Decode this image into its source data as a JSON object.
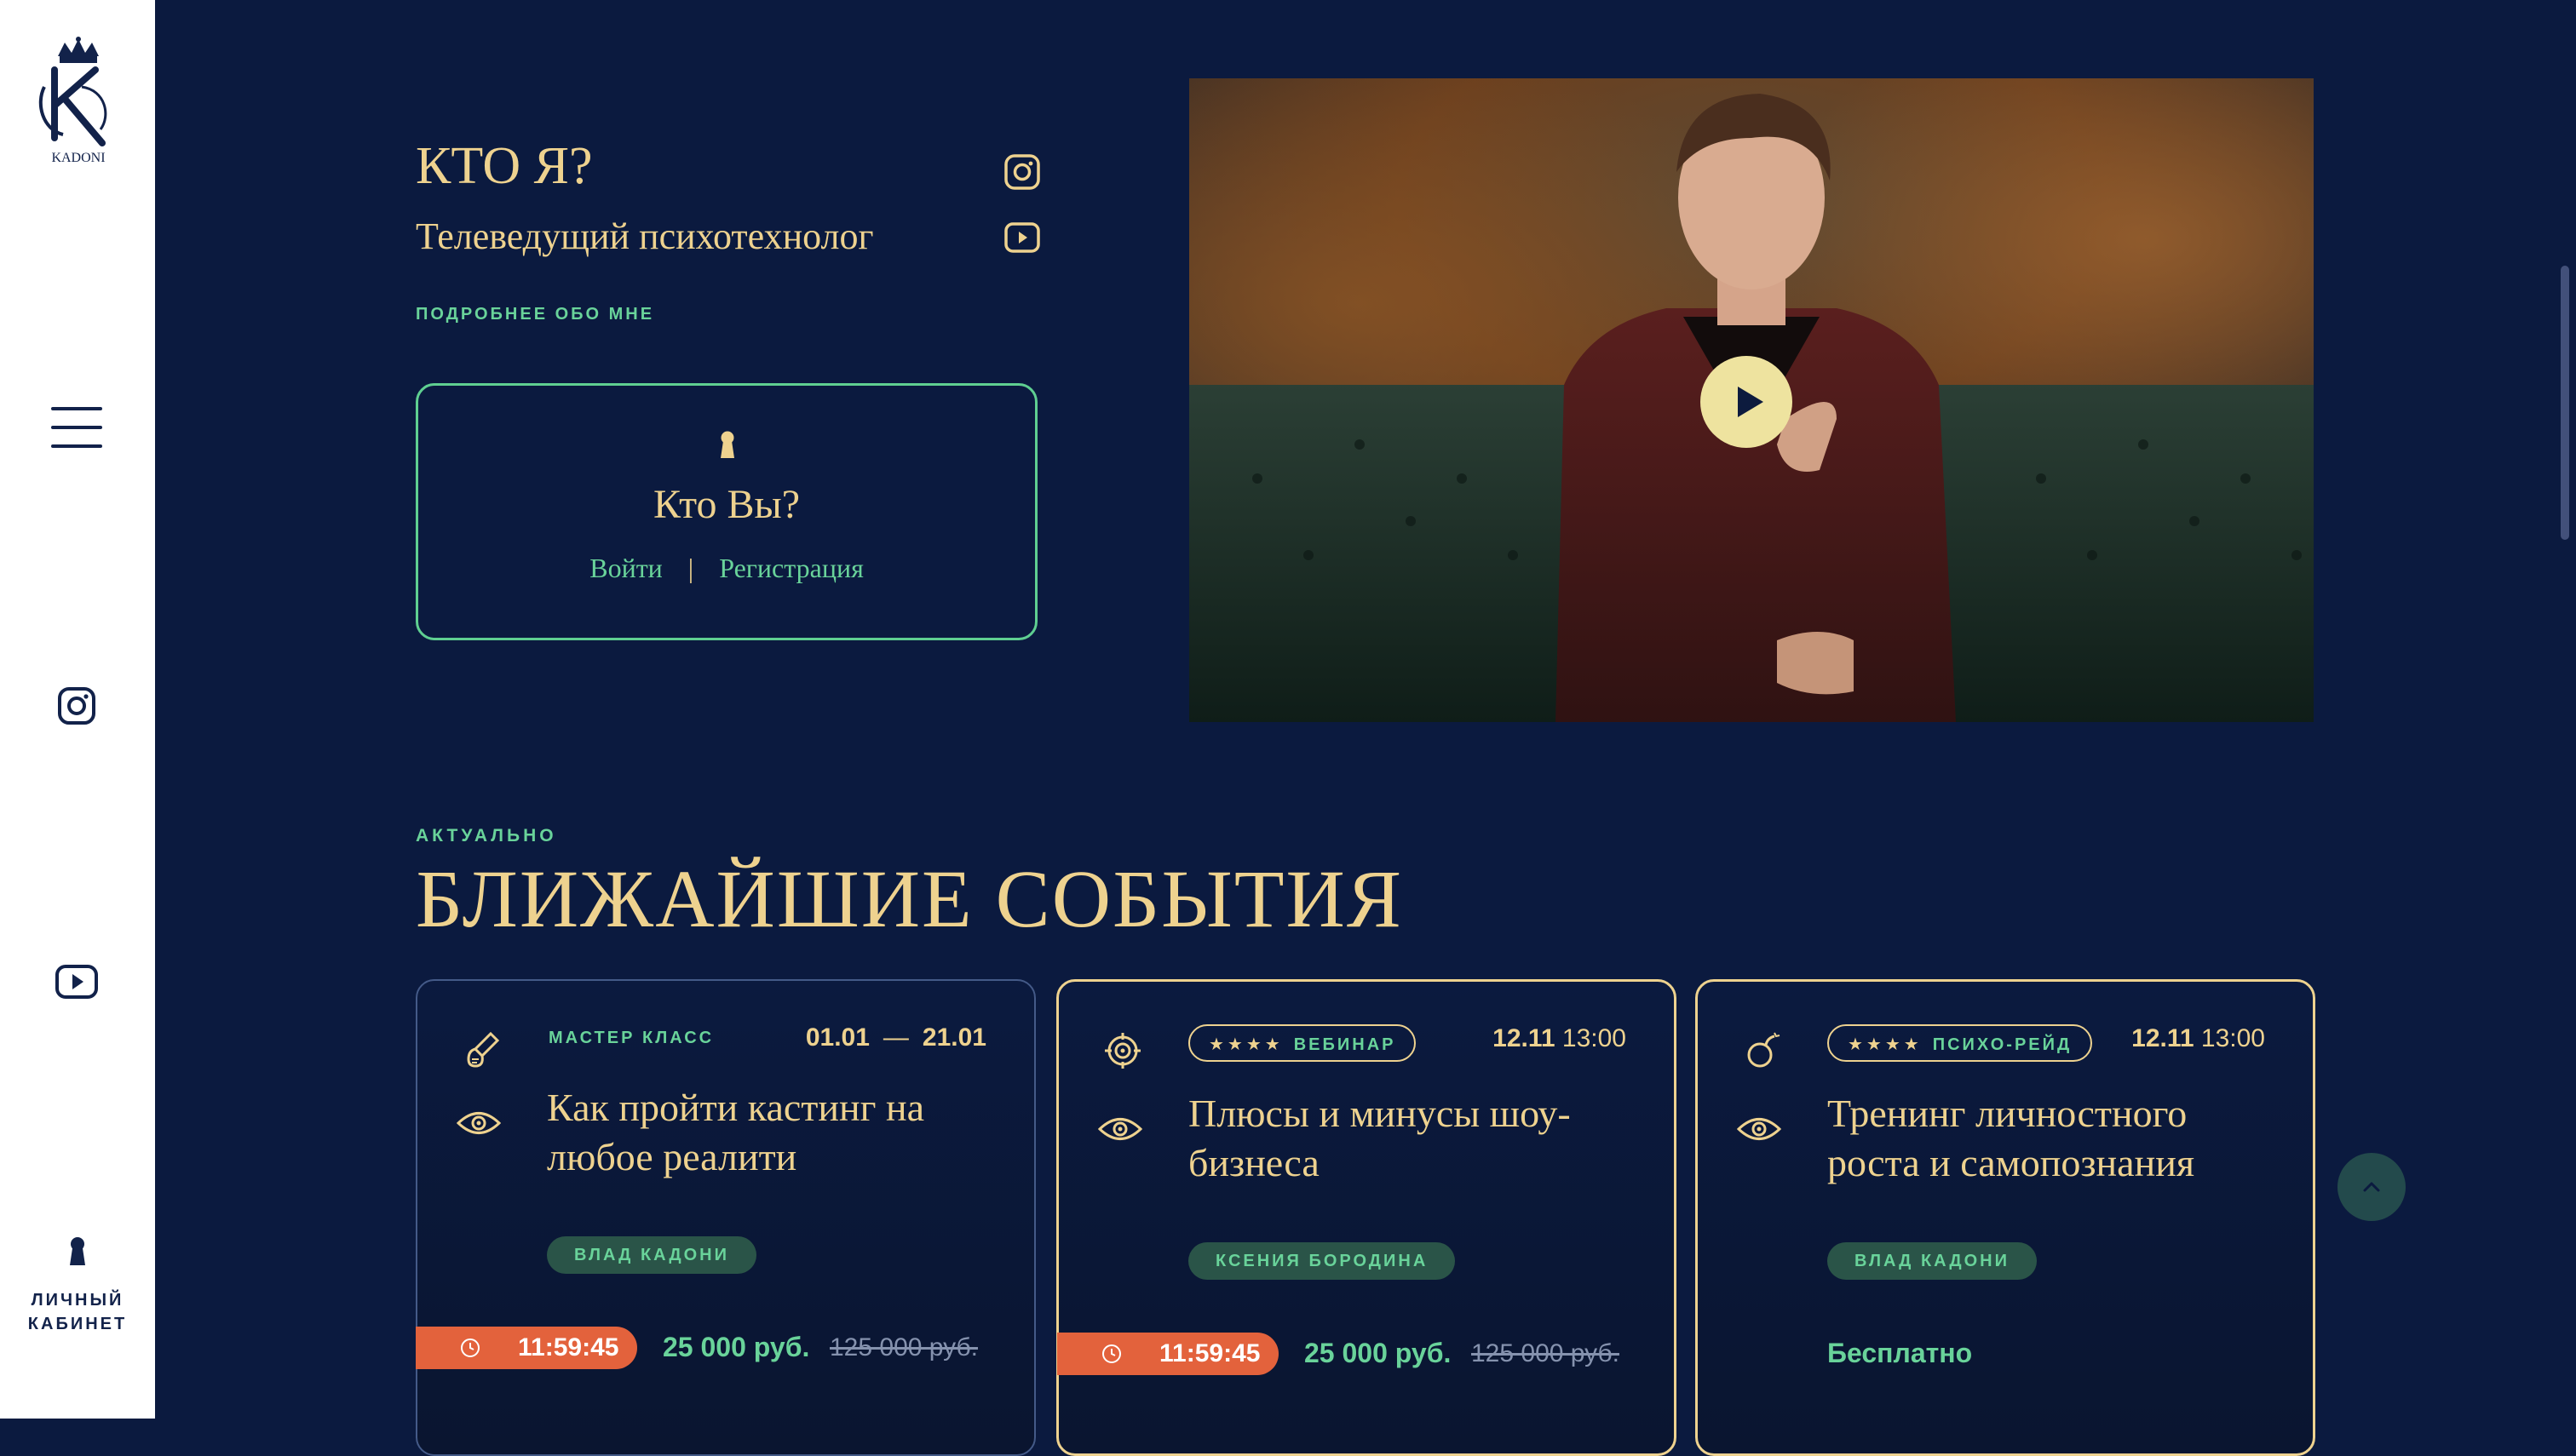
{
  "brand": {
    "logo_text": "KADONI"
  },
  "sidebar": {
    "cabinet_label": "ЛИЧНЫЙ КАБИНЕТ"
  },
  "about": {
    "title": "КТО Я?",
    "subtitle": "Телеведущий психотехнолог",
    "more_link": "ПОДРОБНЕЕ ОБО МНЕ"
  },
  "login_box": {
    "title": "Кто Вы?",
    "login": "Войти",
    "separator": "|",
    "register": "Регистрация"
  },
  "events": {
    "kicker": "АКТУАЛЬНО",
    "title": "БЛИЖАЙШИЕ СОБЫТИЯ",
    "cards": [
      {
        "type": "МАСТЕР КЛАСС",
        "date_from": "01.01",
        "date_sep": "—",
        "date_to": "21.01",
        "title": "Как пройти кастинг на любое реалити",
        "author": "ВЛАД КАДОНИ",
        "timer": "11:59:45",
        "price": "25 000 руб.",
        "old_price": "125 000 руб."
      },
      {
        "stars": "★★★★",
        "type": "ВЕБИНАР",
        "date": "12.11",
        "time": "13:00",
        "title": "Плюсы и минусы шоу-бизнеса",
        "author": "КСЕНИЯ БОРОДИНА",
        "timer": "11:59:45",
        "price": "25 000 руб.",
        "old_price": "125 000 руб."
      },
      {
        "stars": "★★★★",
        "type": "ПСИХО-РЕЙД",
        "date": "12.11",
        "time": "13:00",
        "title": "Тренинг личностного роста и самопознания",
        "author": "ВЛАД КАДОНИ",
        "price": "Бесплатно"
      }
    ]
  },
  "colors": {
    "background": "#0b1a3f",
    "gold": "#eed28f",
    "green": "#69d39a",
    "timer": "#e3623c"
  }
}
